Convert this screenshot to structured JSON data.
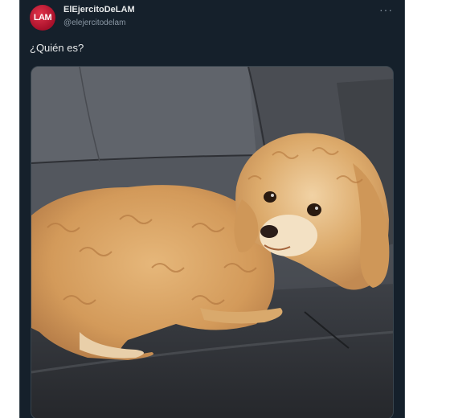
{
  "tweet": {
    "avatar_text": "LAM",
    "display_name": "ElEjercitoDeLAM",
    "handle": "@elejercitodelam",
    "more_icon": "more-horizontal-icon",
    "text": "¿Quién es?",
    "media": {
      "description_icon": "photo-icon"
    }
  },
  "colors": {
    "background": "#15202b",
    "text_primary": "#e7e9ea",
    "text_secondary": "#8b98a5",
    "avatar_red": "#c8142f",
    "border": "#38444d"
  }
}
